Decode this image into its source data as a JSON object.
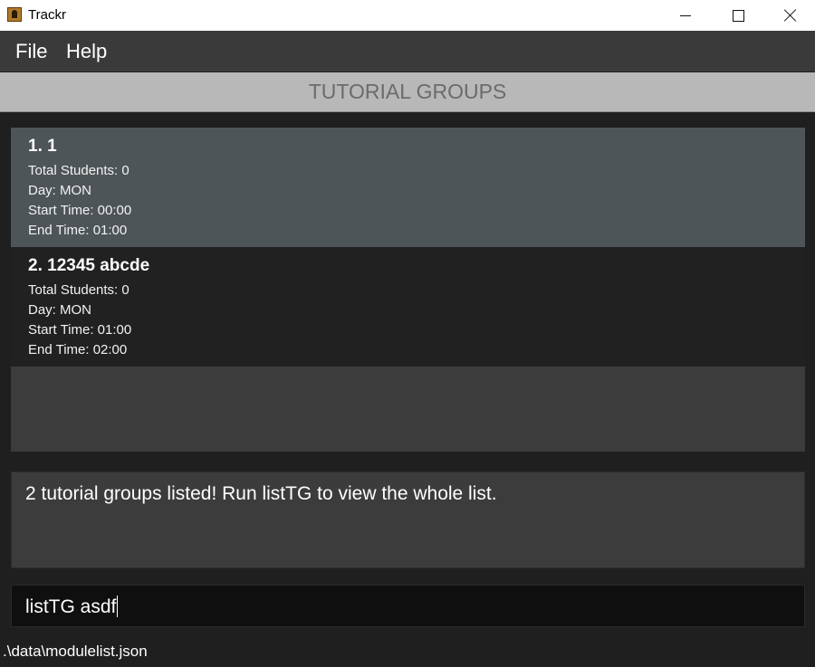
{
  "window": {
    "title": "Trackr",
    "minimize_icon": "minimize-icon",
    "maximize_icon": "maximize-icon",
    "close_icon": "close-icon"
  },
  "menu": {
    "items": [
      "File",
      "Help"
    ]
  },
  "header": {
    "title": "TUTORIAL GROUPS"
  },
  "tutorial_groups": [
    {
      "title": "1.  1",
      "total_students": "Total Students: 0",
      "day": "Day: MON",
      "start_time": "Start Time: 00:00",
      "end_time": "End Time: 01:00",
      "selected": true
    },
    {
      "title": "2.  12345 abcde",
      "total_students": "Total Students: 0",
      "day": "Day: MON",
      "start_time": "Start Time: 01:00",
      "end_time": "End Time: 02:00",
      "selected": false
    }
  ],
  "result": {
    "text": "2 tutorial groups listed! Run listTG to view the whole list."
  },
  "command": {
    "value": "listTG asdf"
  },
  "status": {
    "path": ".\\data\\modulelist.json"
  },
  "colors": {
    "menubar": "#3a3a3a",
    "header": "#b8b8b8",
    "selected_card": "#4e5558"
  }
}
